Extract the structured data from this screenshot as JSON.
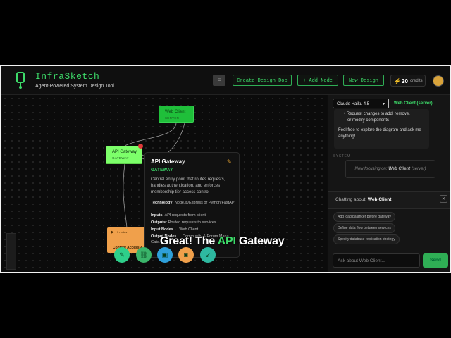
{
  "header": {
    "title": "InfraSketch",
    "subtitle": "Agent-Powered System Design Tool",
    "buttons": {
      "create_design_doc": "Create Design Doc",
      "add_node": "+ Add Node",
      "new_design": "New Design"
    },
    "menu_icon": "≡",
    "credits": {
      "count": "20",
      "label": "credits"
    }
  },
  "canvas": {
    "nodes": {
      "web_client": {
        "label": "Web Client",
        "type": "SERVER"
      },
      "api_gateway": {
        "label": "API Gateway",
        "type": "GATEWAY"
      },
      "content": {
        "top_label": "3 nodes",
        "label": "Content Access & M"
      }
    },
    "popup": {
      "title": "API Gateway",
      "type": "GATEWAY",
      "description": "Central entry point that routes requests, handles authentication, and enforces membership tier access control",
      "technology_label": "Technology:",
      "technology_value": "Node.js/Express or Python/FastAPI",
      "inputs_label": "Inputs:",
      "inputs_value": "API requests from client",
      "outputs_label": "Outputs:",
      "outputs_value": "Routed requests to services",
      "input_nodes_label": "Input Nodes ←",
      "input_nodes_value": "Web Client",
      "output_nodes_label": "Output Nodes →",
      "output_nodes_value": "Community & Forum Mana… Gate…"
    },
    "caption": {
      "prefix": "Great! The ",
      "highlight": "API",
      "suffix": " Gateway"
    },
    "tools": [
      "edit-icon",
      "link-icon",
      "group-icon",
      "save-icon",
      "collapse-icon"
    ]
  },
  "chat": {
    "model": "Claude Haiku 4.5",
    "focus": "Web Client (server)",
    "bullets": [
      "Request changes to add, remove,",
      "or modify components"
    ],
    "message": "Feel free to explore the diagram and ask me anything!",
    "system_label": "SYSTEM",
    "system_prefix": "Now focusing on: ",
    "system_focus": "Web Client",
    "system_suffix": " (server)",
    "chatting_prefix": "Chatting about: ",
    "chatting_about": "Web Client",
    "suggestions": [
      "Add load balancer before gateway",
      "Define data flow between services",
      "Specify database replication strategy"
    ],
    "input_placeholder": "Ask about Web Client...",
    "send_label": "Send"
  },
  "colors": {
    "accent": "#3ddc6a",
    "node_green": "#1fbf3a",
    "node_selected": "#7dff6a",
    "node_orange": "#f0a04b"
  }
}
